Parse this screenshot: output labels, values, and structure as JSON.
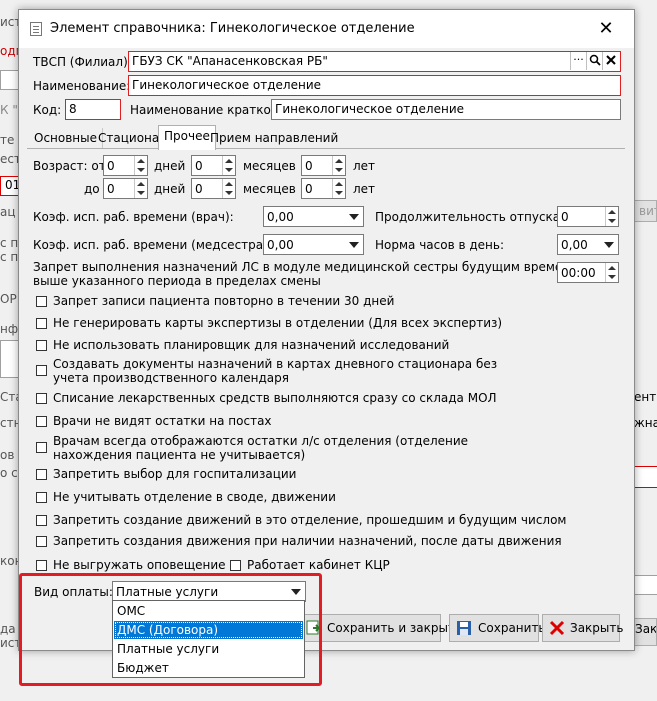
{
  "window": {
    "title": "Элемент справочника: Гинекологическое отделение",
    "close_glyph": "✕"
  },
  "form": {
    "tvsp_label": "ТВСП (Филиал):",
    "tvsp_value": "ГБУЗ СК \"Апанасенковская РБ\"",
    "name_label": "Наименование:",
    "name_value": "Гинекологическое отделение",
    "code_label": "Код:",
    "code_value": "8",
    "short_name_label": "Наименование краткое:",
    "short_name_value": "Гинекологическое отделение"
  },
  "tabs": [
    {
      "label": "Основные"
    },
    {
      "label": "Стационар"
    },
    {
      "label": "Прочее"
    },
    {
      "label": "Прием направлений"
    }
  ],
  "age": {
    "label": "Возраст: от",
    "to_label": "до",
    "days": "дней",
    "months": "месяцев",
    "years": "лет",
    "from_days": "0",
    "from_months": "0",
    "from_years": "0",
    "to_days": "0",
    "to_months": "0",
    "to_years": "0"
  },
  "params": {
    "doctor_coef_label": "Коэф. исп. раб. времени (врач):",
    "doctor_coef_value": "0,00",
    "nurse_coef_label": "Коэф. исп. раб. времени (медсестра):",
    "nurse_coef_value": "0,00",
    "vacation_label": "Продолжительность отпуска:",
    "vacation_value": "0",
    "hours_label": "Норма часов в день:",
    "hours_value": "0,00",
    "ban_text_1": "Запрет выполнения назначений ЛС в модуле медицинской сестры будущим временем",
    "ban_text_2": "выше указанного периода в пределах смены",
    "ban_time_value": "00:00"
  },
  "checkboxes": [
    {
      "label": "Запрет записи пациента повторно в течении 30 дней"
    },
    {
      "label": "Не генерировать карты экспертизы в отделении (Для всех экспертиз)"
    },
    {
      "label": "Не использовать планировщик для назначений исследований"
    },
    {
      "label": "Создавать документы назначений в картах дневного стационара без",
      "label2": "учета производственного календаря"
    },
    {
      "label": "Списание лекарственных средств выполняются сразу со склада МОЛ"
    },
    {
      "label": "Врачи не видят остатки на постах"
    },
    {
      "label": "Врачам всегда отображаются остатки л/с отделения (отделение",
      "label2": "нахождения пациента не учитывается)"
    },
    {
      "label": "Запретить выбор для госпитализации"
    },
    {
      "label": "Не учитывать отделение в своде, движении"
    },
    {
      "label": "Запретить создание движений в это отделение, прошедшим и будущим числом"
    },
    {
      "label": "Запретить создания движения при наличии назначений, после даты движения"
    },
    {
      "label": "Не выгружать оповещение"
    },
    {
      "label": "Работает кабинет КЦР"
    }
  ],
  "payment": {
    "label": "Вид оплаты:",
    "selected": "Платные услуги",
    "options": [
      "ОМС",
      "ДМС (Договора)",
      "Платные услуги",
      "Бюджет"
    ],
    "highlighted_option": "ДМС (Договора)"
  },
  "buttons": {
    "save_close": "Сохранить и закрыть",
    "save": "Сохранить",
    "close": "Закрыть"
  },
  "background": {
    "t1": "истр",
    "t2": "одп",
    "t3": "К \"А",
    "t4": "те",
    "t5": "ест",
    "t6": "01",
    "t7": "ац",
    "t8": "с п",
    "t9": "с п",
    "t10": "ОР",
    "t11": "нфо",
    "t12": "Ста",
    "t13": "стн",
    "t14": "ов",
    "t15": "о с",
    "t16": "кон",
    "t17": "да",
    "t18": "ист",
    "r1": "вите",
    "r2": "ент",
    "r3": "жна",
    "r4": "Закр"
  },
  "colors": {
    "accent": "#0078d7",
    "highlight_frame": "#e31b23",
    "required_border": "#e02020"
  }
}
